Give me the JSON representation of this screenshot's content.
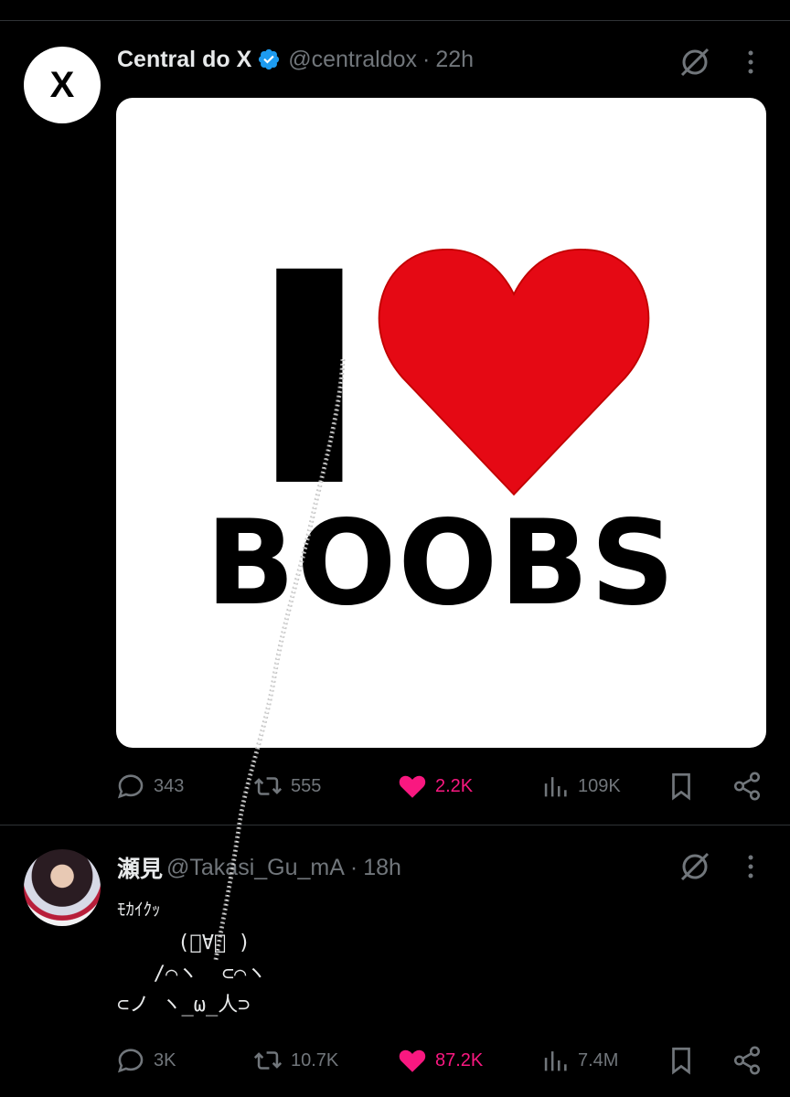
{
  "tweets": [
    {
      "name": "Central do X",
      "handle": "@centraldox",
      "time": "22h",
      "avatar_letter": "X",
      "verified": true,
      "image": {
        "line1": "I",
        "line2": "BOOBS",
        "heart_color": "#e50914"
      },
      "actions": {
        "replies": "343",
        "reposts": "555",
        "likes": "2.2K",
        "views": "109K"
      }
    },
    {
      "name": "瀬見",
      "handle": "@Takasi_Gu_mA",
      "time": "18h",
      "text_lines": [
        "ﾓｶｲｸｯ",
        "     (ﾟ∀ﾟ )",
        "   /⌒ヽ  ⊂⌒ヽ",
        "⊂ノ ヽ_ω_人⊃"
      ],
      "actions": {
        "replies": "3K",
        "reposts": "10.7K",
        "likes": "87.2K",
        "views": "7.4M"
      }
    }
  ],
  "colors": {
    "background": "#000000",
    "muted": "#71767b",
    "like": "#f91880",
    "verified": "#1d9bf0"
  },
  "icons": [
    "reply-icon",
    "repost-icon",
    "like-icon",
    "views-icon",
    "bookmark-icon",
    "share-icon",
    "grok-icon",
    "more-icon",
    "verified-badge-icon"
  ]
}
